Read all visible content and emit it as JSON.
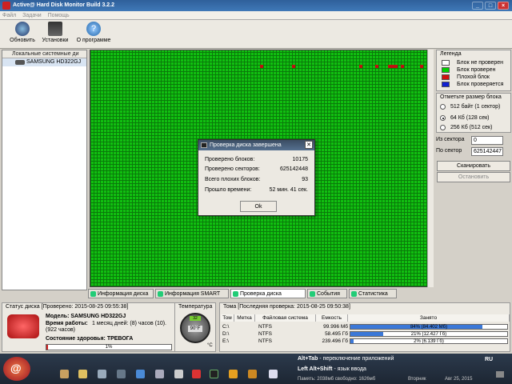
{
  "window": {
    "title": "Active@ Hard Disk Monitor Build 3.2.2"
  },
  "menu": [
    "Файл",
    "Задачи",
    "Помощь"
  ],
  "toolbar": {
    "refresh": "Обновить",
    "settings": "Установки",
    "about": "О программе"
  },
  "tree": {
    "header": "Локальные системные ди",
    "disk": "SAMSUNG HD322GJ"
  },
  "legend": {
    "title": "Легенда",
    "items": [
      {
        "label": "Блок не проверен",
        "color": "#ffffff"
      },
      {
        "label": "Блок проверен",
        "color": "#00d000"
      },
      {
        "label": "Плохой блок",
        "color": "#d01010"
      },
      {
        "label": "Блок проверяется",
        "color": "#1020d0"
      }
    ]
  },
  "blocksize": {
    "title": "Отметьте размер блока",
    "options": [
      "512 байт (1 сектор)",
      "64 Кб (128 сек)",
      "256 Кб (512 сек)"
    ],
    "selected_index": 1
  },
  "range": {
    "from_label": "Из сектора",
    "from_value": "0",
    "to_label": "По сектор",
    "to_value": "625142447"
  },
  "buttons": {
    "scan": "Сканировать",
    "stop": "Остановить"
  },
  "tabs": [
    "Информация диска",
    "Информация SMART",
    "Проверка диска",
    "События",
    "Статистика"
  ],
  "active_tab": 2,
  "dialog": {
    "title": "Проверка диска завершена",
    "rows": [
      {
        "label": "Проверено блоков:",
        "value": "10175"
      },
      {
        "label": "Проверено секторов:",
        "value": "625142448"
      },
      {
        "label": "Всего плохих блоков:",
        "value": "93"
      },
      {
        "label": "Прошло времени:",
        "value": "52 мин. 41 сек."
      }
    ],
    "ok": "Ok"
  },
  "status": {
    "title": "Статус диска [Проверено: 2015-08-25 09:55:38]",
    "model": "Модель: SAMSUNG HD322GJ",
    "uptime_label": "Время работы:",
    "uptime_value": "1 месяц дней: (8) часов (10).",
    "uptime_hours": "(922 часов)",
    "health": "Состояние здоровья: ТРЕВОГА",
    "health_percent": 1,
    "health_text": "1%"
  },
  "temperature": {
    "title": "Температура",
    "value": "90°F",
    "celsius": "32",
    "unit": "°C"
  },
  "volumes": {
    "title": "Тома [Последняя проверка: 2015-08-25 09:50:38]",
    "headers": [
      "Том",
      "Метка",
      "Файловая система",
      "Емкость",
      "Занято"
    ],
    "rows": [
      {
        "vol": "C:\\",
        "label": "",
        "fs": "NTFS",
        "capacity": "99.996 Мб",
        "used_pct": 84,
        "used_text": "84% (84.402 Мб)"
      },
      {
        "vol": "D:\\",
        "label": "",
        "fs": "NTFS",
        "capacity": "58.495 Гб",
        "used_pct": 21,
        "used_text": "21% (12.427 Гб)"
      },
      {
        "vol": "E:\\",
        "label": "",
        "fs": "NTFS",
        "capacity": "239.496 Гб",
        "used_pct": 2,
        "used_text": "2% (6.139 Гб)"
      }
    ]
  },
  "taskbar": {
    "hint1_key": "Alt+Tab",
    "hint1": " - переключение приложений",
    "hint2_key": "Left Alt+Shift",
    "hint2": " - язык ввода",
    "memory": "Память: 2038мб свободно: 1626мб",
    "day": "Вторник",
    "date": "Авг 25, 2015",
    "lang": "RU"
  },
  "colors": {
    "grid_green": "#10c010",
    "bad_block": "#c01010",
    "title_blue": "#3f79b8"
  }
}
